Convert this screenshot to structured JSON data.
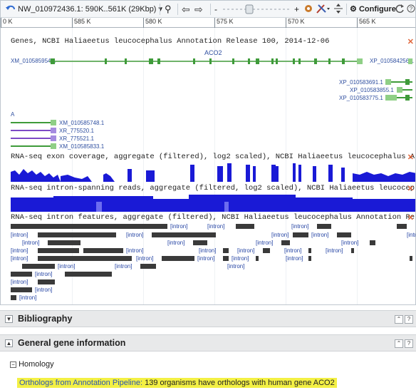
{
  "toolbar": {
    "location": "NW_010972436.1: 590K..561K (29Kbp)",
    "configure_label": "Configure"
  },
  "ruler": {
    "ticks": [
      "0 K",
      "585 K",
      "580 K",
      "575 K",
      "570 K",
      "565 K"
    ]
  },
  "tracks": {
    "genes_title": "Genes, NCBI Haliaeetus leucocephalus Annotation Release 100, 2014-12-06",
    "gene_name": "ACO2",
    "gene_labels": [
      "XM_010585954.1",
      "XP_010584256.1",
      "XP_010583691.1",
      "XP_010583855.1",
      "XP_010583775.1",
      "XM_010585748.1",
      "XR_775520.1",
      "XR_775521.1",
      "XM_010585833.1"
    ],
    "exon_coverage_title": "RNA-seq exon coverage, aggregate (filtered), log2 scaled), NCBI Haliaeetus leucocephalus Anno",
    "intron_reads_title": "RNA-seq intron-spanning reads, aggregate (filtered, log2 scaled), NCBI Haliaeetus leucocepha",
    "intron_features_title": "RNA-seq intron features, aggregate (filtered), NCBI Haliaeetus leucocephalus Annotation Rele",
    "intron_label": "[intron]"
  },
  "sections": {
    "bibliography": "Bibliography",
    "general_gene_info": "General gene information"
  },
  "homology": {
    "label": "Homology",
    "orthologs_link": "Orthologs from Annotation Pipeline:",
    "orthologs_text": "139 organisms have orthologs with human gene ACO2"
  },
  "colors": {
    "gene_green": "#3f9b3a",
    "coverage_blue": "#1a1ad6",
    "highlight_yellow": "#f3f044",
    "close_orange": "#e0663b"
  }
}
